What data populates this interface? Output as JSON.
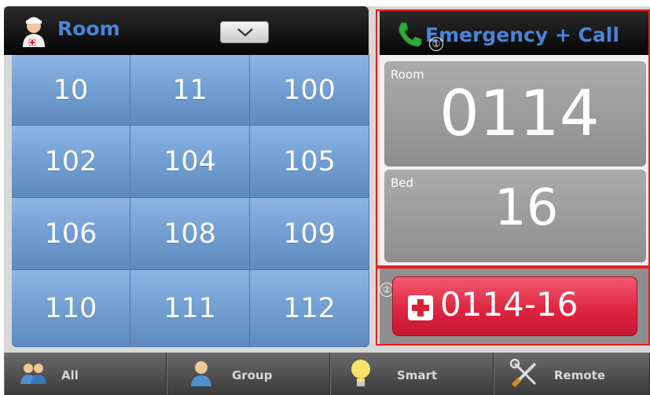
{
  "left_header": {
    "title": "Room",
    "nurse_icon": "nurse-icon",
    "dropdown_icon": "chevron-down-icon"
  },
  "rooms": [
    [
      "10",
      "11",
      "100"
    ],
    [
      "102",
      "104",
      "105"
    ],
    [
      "106",
      "108",
      "109"
    ],
    [
      "110",
      "111",
      "112"
    ]
  ],
  "right_header": {
    "title": "Emergency + Call",
    "phone_icon": "phone-icon"
  },
  "markers": [
    "①",
    "②"
  ],
  "info": {
    "room_label": "Room",
    "room_value": "0114",
    "bed_label": "Bed",
    "bed_value": "16"
  },
  "call_button": {
    "label": "0114-16",
    "icon": "red-cross-icon"
  },
  "tabs": [
    {
      "label": "All",
      "icon": "people-icon"
    },
    {
      "label": "Group",
      "icon": "person-icon"
    },
    {
      "label": "Smart",
      "icon": "lightbulb-icon"
    },
    {
      "label": "Remote",
      "icon": "tools-icon"
    }
  ],
  "colors": {
    "header_text": "#4a84d8",
    "highlight_frame": "#ee1c1c",
    "call_button": "#dd2642",
    "grid_cell": "#74a1d4"
  }
}
